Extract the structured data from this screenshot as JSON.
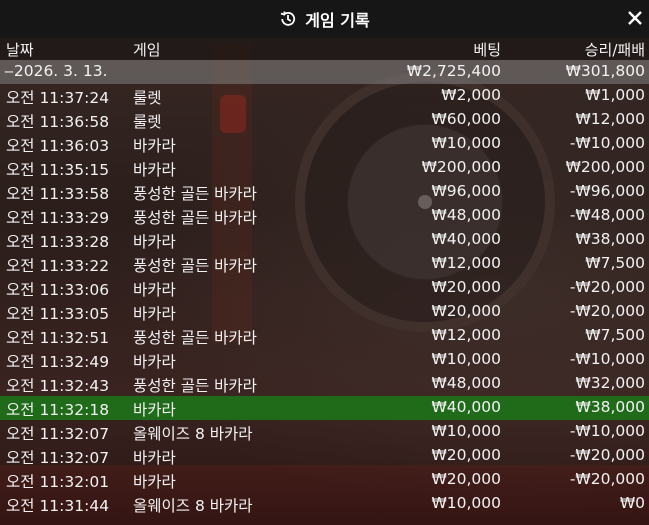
{
  "header": {
    "title": "게임 기록",
    "history_icon": "history-icon",
    "close_icon": "close-icon"
  },
  "columns": {
    "date": "날짜",
    "game": "게임",
    "bet": "베팅",
    "result": "승리/패배"
  },
  "summary": {
    "date": "‒2026. 3. 13.",
    "bet": "₩2,725,400",
    "result": "₩301,800"
  },
  "rows": [
    {
      "time": "오전 11:37:24",
      "game": "룰렛",
      "bet": "₩2,000",
      "result": "₩1,000"
    },
    {
      "time": "오전 11:36:58",
      "game": "룰렛",
      "bet": "₩60,000",
      "result": "₩12,000"
    },
    {
      "time": "오전 11:36:03",
      "game": "바카라",
      "bet": "₩10,000",
      "result": "-₩10,000"
    },
    {
      "time": "오전 11:35:15",
      "game": "바카라",
      "bet": "₩200,000",
      "result": "₩200,000"
    },
    {
      "time": "오전 11:33:58",
      "game": "풍성한 골든 바카라",
      "bet": "₩96,000",
      "result": "-₩96,000"
    },
    {
      "time": "오전 11:33:29",
      "game": "풍성한 골든 바카라",
      "bet": "₩48,000",
      "result": "-₩48,000"
    },
    {
      "time": "오전 11:33:28",
      "game": "바카라",
      "bet": "₩40,000",
      "result": "₩38,000"
    },
    {
      "time": "오전 11:33:22",
      "game": "풍성한 골든 바카라",
      "bet": "₩12,000",
      "result": "₩7,500"
    },
    {
      "time": "오전 11:33:06",
      "game": "바카라",
      "bet": "₩20,000",
      "result": "-₩20,000"
    },
    {
      "time": "오전 11:33:05",
      "game": "바카라",
      "bet": "₩20,000",
      "result": "-₩20,000"
    },
    {
      "time": "오전 11:32:51",
      "game": "풍성한 골든 바카라",
      "bet": "₩12,000",
      "result": "₩7,500"
    },
    {
      "time": "오전 11:32:49",
      "game": "바카라",
      "bet": "₩10,000",
      "result": "-₩10,000"
    },
    {
      "time": "오전 11:32:43",
      "game": "풍성한 골든 바카라",
      "bet": "₩48,000",
      "result": "₩32,000"
    },
    {
      "time": "오전 11:32:18",
      "game": "바카라",
      "bet": "₩40,000",
      "result": "₩38,000"
    },
    {
      "time": "오전 11:32:07",
      "game": "올웨이즈 8 바카라",
      "bet": "₩10,000",
      "result": "-₩10,000"
    },
    {
      "time": "오전 11:32:07",
      "game": "바카라",
      "bet": "₩20,000",
      "result": "-₩20,000"
    },
    {
      "time": "오전 11:32:01",
      "game": "바카라",
      "bet": "₩20,000",
      "result": "-₩20,000"
    },
    {
      "time": "오전 11:31:44",
      "game": "올웨이즈 8 바카라",
      "bet": "₩10,000",
      "result": "₩0"
    }
  ],
  "highlighted_row": 13,
  "colors": {
    "highlight": "#1f6b1a",
    "summary": "#8a8a8a",
    "titlebar": "#161616"
  }
}
